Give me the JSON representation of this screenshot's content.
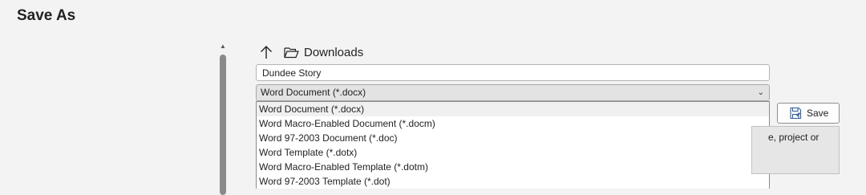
{
  "page": {
    "title": "Save As"
  },
  "location": {
    "folder_name": "Downloads",
    "up_icon": "arrow-up-icon",
    "folder_icon": "folder-open-icon"
  },
  "file": {
    "name_value": "Dundee Story",
    "type_selected": "Word Document (*.docx)"
  },
  "file_types": [
    "Word Document (*.docx)",
    "Word Macro-Enabled Document (*.docm)",
    "Word 97-2003 Document (*.doc)",
    "Word Template (*.dotx)",
    "Word Macro-Enabled Template (*.dotm)",
    "Word 97-2003 Template (*.dot)"
  ],
  "actions": {
    "save_label": "Save",
    "save_icon": "save-floppy-icon"
  },
  "info": {
    "partial_text": "e, project or"
  }
}
